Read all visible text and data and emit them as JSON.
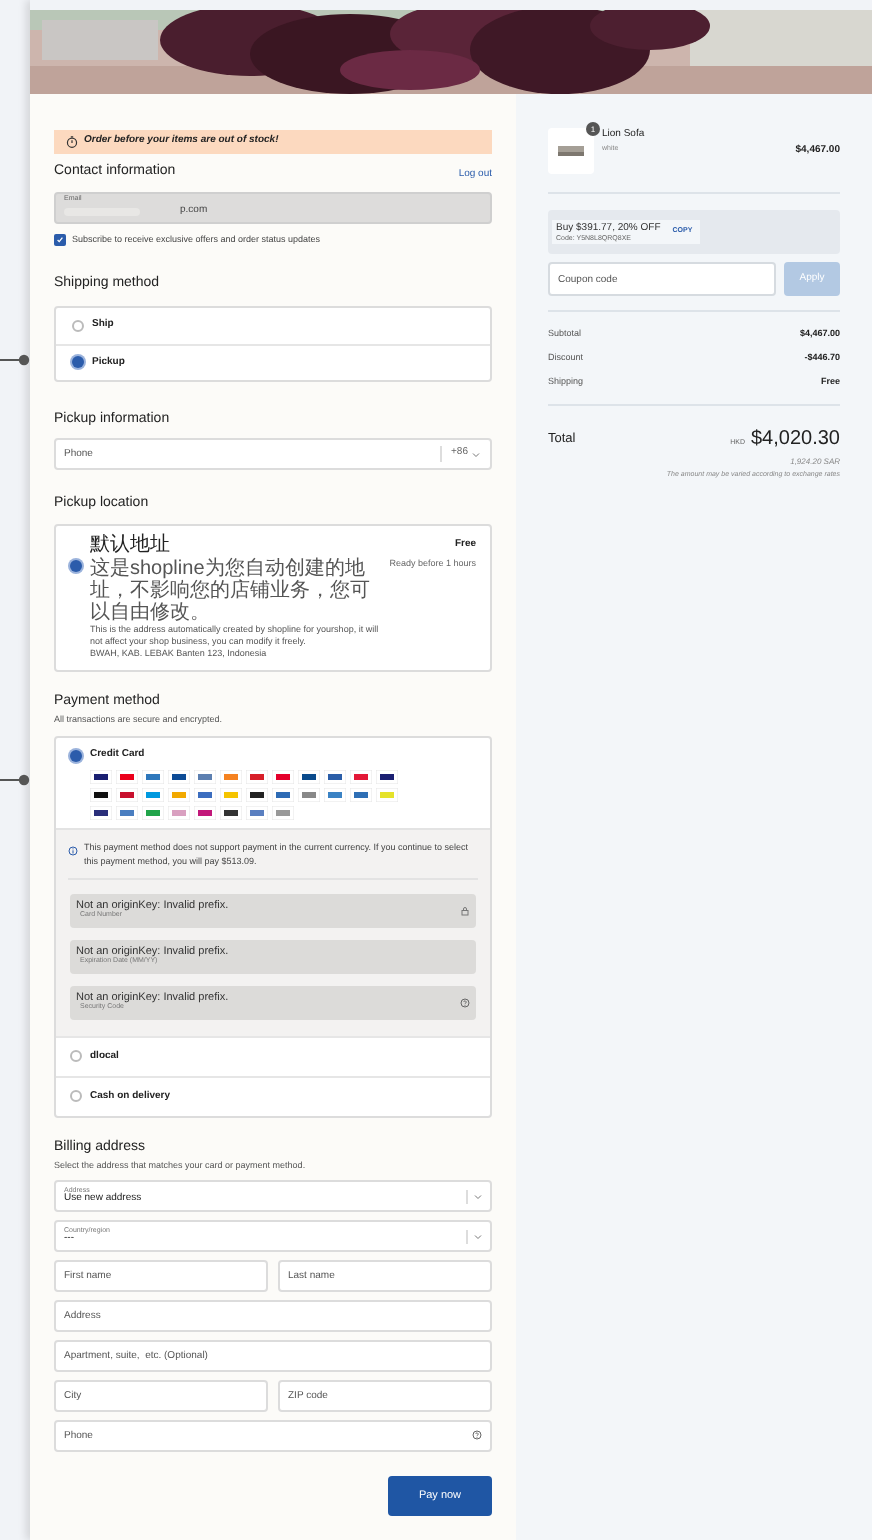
{
  "alert": "Order before your items are out of stock!",
  "contact": {
    "title": "Contact information",
    "logout": "Log out",
    "email_label": "Email",
    "email_value": "p.com",
    "subscribe": {
      "label": "Subscribe to receive exclusive offers and order status updates",
      "checked": true
    }
  },
  "shipping": {
    "title": "Shipping method",
    "options": [
      {
        "label": "Ship",
        "selected": false
      },
      {
        "label": "Pickup",
        "selected": true
      }
    ]
  },
  "pickup_info": {
    "title": "Pickup information",
    "phone_placeholder": "Phone",
    "country_code": "+86"
  },
  "pickup_location": {
    "title": "Pickup location",
    "selected": true,
    "name": "默认地址",
    "price": "Free",
    "description_zh": "这是shopline为您自动创建的地址，不影响您的店铺业务，您可以自由修改。",
    "description_en": "This is the address automatically created by shopline for yourshop, it will not affect your shop business, you can modify it freely.",
    "address": "BWAH, KAB. LEBAK Banten 123, Indonesia",
    "ready": "Ready before 1 hours"
  },
  "payment": {
    "title": "Payment method",
    "subtitle": "All transactions are secure and encrypted.",
    "methods": [
      {
        "kind": "card",
        "label": "Credit Card",
        "selected": true,
        "notice": "This payment method does not support payment in the current currency. If you continue to select this payment method, you will pay $513.09.",
        "fields": [
          {
            "kind": "number",
            "error": "Not an originKey: Invalid prefix.",
            "label": "Card Number"
          },
          {
            "kind": "expiry",
            "error": "Not an originKey: Invalid prefix.",
            "label": "Expiration Date  (MM/YY)"
          },
          {
            "kind": "cvc",
            "error": "Not an originKey: Invalid prefix.",
            "label": "Security Code"
          }
        ]
      },
      {
        "kind": "plain",
        "label": "dlocal",
        "selected": false
      },
      {
        "kind": "plain",
        "label": "Cash on delivery",
        "selected": false
      }
    ]
  },
  "billing": {
    "title": "Billing address",
    "subtitle": "Select the address that matches your card or payment method.",
    "rows": [
      {
        "kind": "select",
        "label": "Address",
        "value": "Use new address"
      },
      {
        "kind": "select",
        "label": "Country/region",
        "value": "---"
      },
      {
        "kind": "pair",
        "placeholders": [
          "First name",
          "Last name"
        ]
      },
      {
        "kind": "text",
        "placeholder": "Address"
      },
      {
        "kind": "text",
        "placeholder": "Apartment, suite,  etc. (Optional)"
      },
      {
        "kind": "pair",
        "placeholders": [
          "City",
          "ZIP code"
        ]
      },
      {
        "kind": "help",
        "placeholder": "Phone"
      }
    ]
  },
  "pay_button": "Pay now",
  "summary": {
    "product": {
      "quantity": "1",
      "name": "Lion Sofa",
      "variant": "white",
      "price": "$4,467.00"
    },
    "promo": {
      "text": "Buy $391.77, 20% OFF",
      "code": "Code: Y5N8L8QRQ8XE",
      "copy": "COPY"
    },
    "coupon_placeholder": "Coupon code",
    "apply": {
      "label": "Apply",
      "disabled": true
    },
    "lines": [
      {
        "label": "Subtotal",
        "value": "$4,467.00"
      },
      {
        "label": "Discount",
        "value": "-$446.70"
      },
      {
        "label": "Shipping",
        "value": "Free"
      }
    ],
    "total": {
      "label": "Total",
      "currency": "HKD",
      "amount": "$4,020.30",
      "converted": "1,924.20 SAR",
      "note": "The amount may be varied according to exchange rates"
    }
  }
}
